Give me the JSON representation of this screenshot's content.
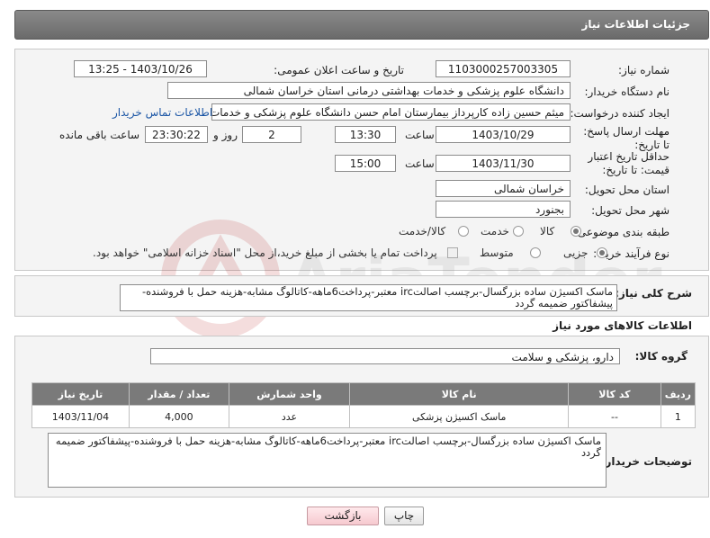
{
  "header": {
    "title": "جزئیات اطلاعات نیاز"
  },
  "form": {
    "need_number_label": "شماره نیاز:",
    "need_number": "1103000257003305",
    "announce_label": "تاریخ و ساعت اعلان عمومی:",
    "announce_value": "1403/10/26 - 13:25",
    "buyer_org_label": "نام دستگاه خریدار:",
    "buyer_org": "دانشگاه علوم پزشکی و خدمات بهداشتی درمانی استان خراسان شمالی",
    "creator_label": "ایجاد کننده درخواست:",
    "creator": "میثم  حسین زاده  کارپرداز بیمارستان امام حسن دانشگاه علوم پزشکی و خدمات",
    "contact_link": "اطلاعات تماس خریدار",
    "deadline_label": "مهلت ارسال پاسخ: تا تاریخ:",
    "deadline_date": "1403/10/29",
    "time_label": "ساعت",
    "deadline_time": "13:30",
    "days_value": "2",
    "days_label": "روز و",
    "remaining_time": "23:30:22",
    "remaining_label": "ساعت باقی مانده",
    "validity_label": "حداقل تاریخ اعتبار قیمت: تا تاریخ:",
    "validity_date": "1403/11/30",
    "validity_time_label": "ساعت",
    "validity_time": "15:00",
    "province_label": "استان محل تحویل:",
    "province": "خراسان شمالی",
    "city_label": "شهر محل تحویل:",
    "city": "بجنورد",
    "category_label": "طبقه بندی موضوعی:",
    "category_options": [
      "کالا",
      "خدمت",
      "کالا/خدمت"
    ],
    "process_label": "نوع فرآیند خرید :",
    "process_options": [
      "جزیی",
      "متوسط"
    ],
    "payment_note": "پرداخت تمام یا بخشی از مبلغ خرید،از محل \"اسناد خزانه اسلامی\" خواهد بود."
  },
  "summary": {
    "label": "شرح کلی نیاز:",
    "text": "ماسک اکسیژن ساده بزرگسال-برچسب اصالتirc معتبر-پرداخت6ماهه-کاتالوگ مشابه-هزینه حمل با فروشنده-پیشفاکتور ضمیمه گردد"
  },
  "goods": {
    "section_title": "اطلاعات کالاهای مورد نیاز",
    "group_label": "گروه کالا:",
    "group_value": "دارو، پزشکی و سلامت",
    "columns": [
      "ردیف",
      "کد کالا",
      "نام کالا",
      "واحد شمارش",
      "تعداد / مقدار",
      "تاریخ نیاز"
    ],
    "rows": [
      [
        "1",
        "--",
        "ماسک اکسیژن پزشکی",
        "عدد",
        "4,000",
        "1403/11/04"
      ]
    ]
  },
  "buyer_notes": {
    "label": "توضیحات خریدار:",
    "text": "ماسک اکسیژن ساده بزرگسال-برچسب اصالتirc معتبر-پرداخت6ماهه-کاتالوگ مشابه-هزینه حمل با فروشنده-پیشفاکتور ضمیمه گردد"
  },
  "buttons": {
    "print": "چاپ",
    "back": "بازگشت"
  },
  "watermark": {
    "brand": "AriaTender.neT"
  }
}
